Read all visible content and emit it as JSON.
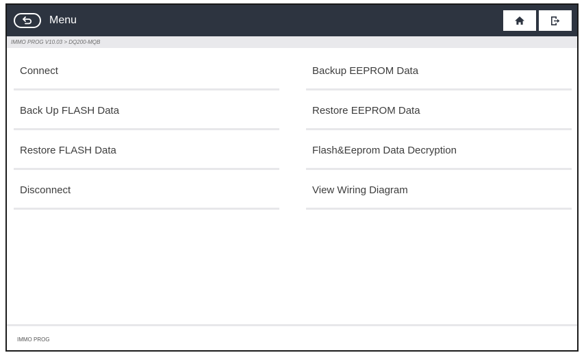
{
  "header": {
    "title": "Menu",
    "back_icon": "back-arrow-icon",
    "home_icon": "home-icon",
    "exit_icon": "exit-icon",
    "bar_color": "#2d3440"
  },
  "breadcrumb": {
    "path": "IMMO PROG V10.03 > DQ200-MQB"
  },
  "menu": {
    "items": [
      {
        "label": "Connect"
      },
      {
        "label": "Backup EEPROM Data"
      },
      {
        "label": "Back Up FLASH Data"
      },
      {
        "label": "Restore EEPROM Data"
      },
      {
        "label": "Restore FLASH Data"
      },
      {
        "label": "Flash&Eeprom Data Decryption"
      },
      {
        "label": "Disconnect"
      },
      {
        "label": "View Wiring Diagram"
      }
    ]
  },
  "footer": {
    "label": "IMMO PROG"
  }
}
